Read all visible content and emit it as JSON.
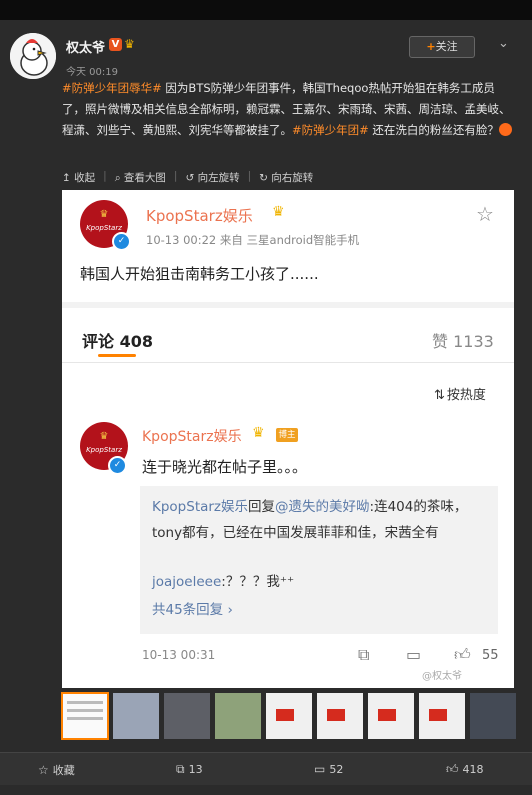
{
  "post": {
    "username": "权太爷",
    "verified_mark": "V",
    "time": "今天 00:19",
    "follow_label": "关注",
    "more_icon": "chevron-down-icon",
    "text": {
      "tag1": "#防弹少年团辱华#",
      "part1": " 因为BTS防弹少年团事件，韩国Theqoo热帖开始狙在韩务工成员了，照片微博及相关信息全部标明，赖冠霖、王嘉尔、宋雨琦、宋茜、周洁琼、孟美岐、程潇、刘些宁、黄旭熙、刘宪华等都被挂了。",
      "tag2": "#防弹少年团#",
      "part2": " 还在洗白的粉丝还有脸？"
    }
  },
  "tools": {
    "collapse": "收起",
    "view_large": "查看大图",
    "rotate_left": "向左旋转",
    "rotate_right": "向右旋转"
  },
  "image": {
    "quoted_post": {
      "logo_text": "KpopStarz",
      "account": "KpopStarz娱乐",
      "meta": "10-13 00:22  来自 三星android智能手机",
      "text": "韩国人开始狙击南韩务工小孩了......"
    },
    "comments_header": {
      "label": "评论 408",
      "likes": "赞 1133",
      "sort": "按热度"
    },
    "comment": {
      "account": "KpopStarz娱乐",
      "badge": "博主",
      "text": "连于晓光都在帖子里。。。",
      "reply1_name": "KpopStarz娱乐",
      "reply1_mid": "回复",
      "reply1_mention": "@遗失的美好呦",
      "reply1_text": ":连404的茶味，tony都有，已经在中国发展菲菲和佳，宋茜全有",
      "reply2_name": "joajoeleee",
      "reply2_text": ":？？？我",
      "reply_more": "共45条回复 ›",
      "time": "10-13 00:31",
      "like_count": "55"
    },
    "watermark": "@权太爷"
  },
  "bottom": {
    "favorite": "收藏",
    "repost": "13",
    "comments": "52",
    "likes": "418"
  },
  "colors": {
    "tag": "#ff8c2a",
    "accent": "#ff8200",
    "link": "#5b7aa8",
    "name": "#eb7350"
  }
}
